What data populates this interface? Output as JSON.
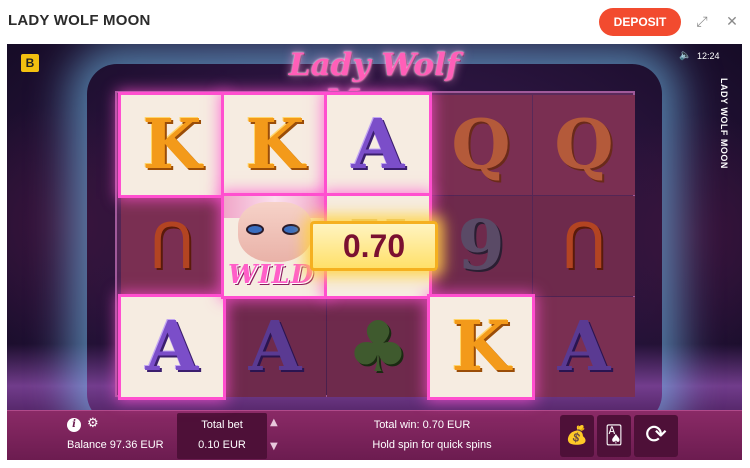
{
  "header": {
    "title": "LADY WOLF MOON",
    "deposit_label": "DEPOSIT",
    "fullscreen_icon": "⤢",
    "close_icon": "✕"
  },
  "game": {
    "logo_text": "Lady Wolf Moon",
    "brand_logo": "B",
    "clock": "12:24",
    "vertical_title": "LADY WOLF MOON",
    "sound_icon": "🔈",
    "reels": [
      [
        "K",
        "horseshoe",
        "A"
      ],
      [
        "K",
        "WILD",
        "A"
      ],
      [
        "A",
        "K",
        "clover"
      ],
      [
        "Q",
        "9",
        "K"
      ],
      [
        "Q",
        "horseshoe",
        "A"
      ]
    ],
    "wild_label": "WILD",
    "win_amount": "0.70"
  },
  "panel": {
    "balance": "Balance 97.36 EUR",
    "total_bet_label": "Total bet",
    "total_bet_value": "0.10 EUR",
    "total_win": "Total win: 0.70 EUR",
    "hint": "Hold spin for quick spins",
    "autoplay_icon": "💰",
    "cards_icon": "🂡",
    "spin_icon": "⟳",
    "bet_up_icon": "▲",
    "bet_down_icon": "▼",
    "info_icon": "i",
    "gear_icon": "⚙"
  },
  "colors": {
    "deposit": "#f24b2f",
    "panel": "#7a2260",
    "win_frame": "#ff4fcf",
    "win_badge": "#ffe06a"
  }
}
